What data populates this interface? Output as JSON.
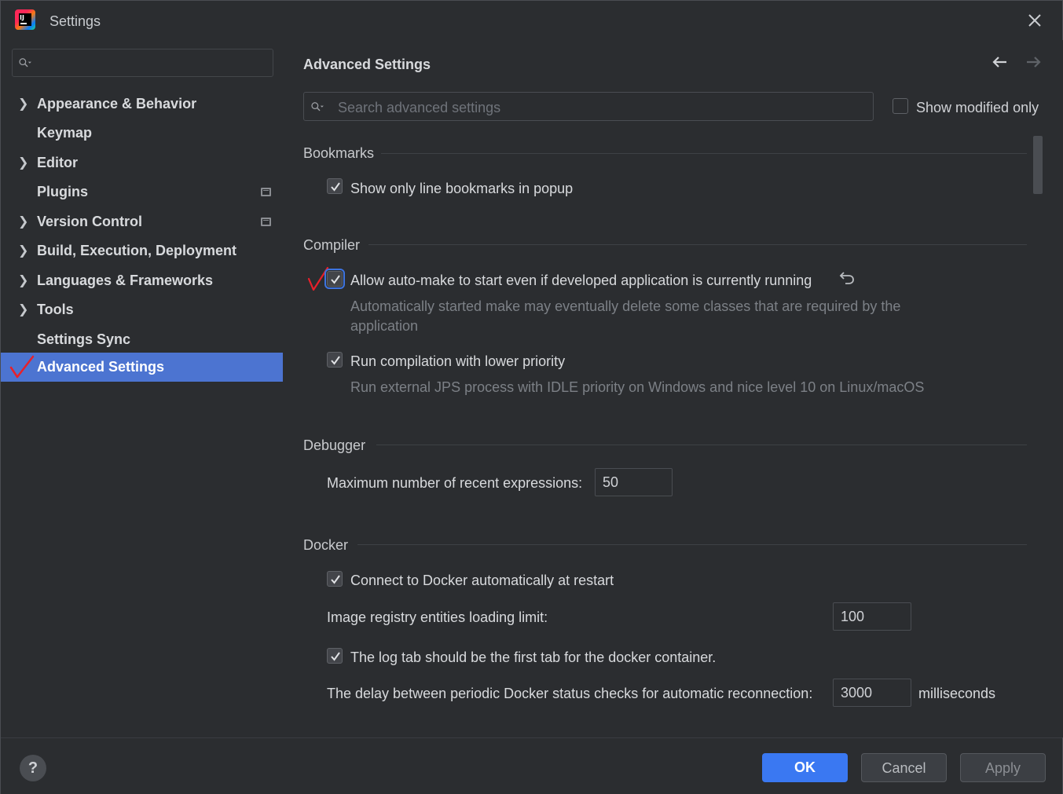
{
  "window": {
    "title": "Settings",
    "app_icon": "intellij-idea-logo",
    "app_icon_text": "IJ"
  },
  "sidebar": {
    "search_placeholder": "",
    "items": [
      {
        "label": "Appearance & Behavior",
        "expandable": true,
        "badge": false
      },
      {
        "label": "Keymap",
        "expandable": false,
        "badge": false
      },
      {
        "label": "Editor",
        "expandable": true,
        "badge": false
      },
      {
        "label": "Plugins",
        "expandable": false,
        "badge": true
      },
      {
        "label": "Version Control",
        "expandable": true,
        "badge": true
      },
      {
        "label": "Build, Execution, Deployment",
        "expandable": true,
        "badge": false
      },
      {
        "label": "Languages & Frameworks",
        "expandable": true,
        "badge": false
      },
      {
        "label": "Tools",
        "expandable": true,
        "badge": false
      },
      {
        "label": "Settings Sync",
        "expandable": false,
        "badge": false
      },
      {
        "label": "Advanced Settings",
        "expandable": false,
        "badge": false,
        "selected": true
      }
    ]
  },
  "main": {
    "title": "Advanced Settings",
    "search_placeholder": "Search advanced settings",
    "show_modified_label": "Show modified only",
    "show_modified_checked": false,
    "sections": {
      "bookmarks": {
        "title": "Bookmarks",
        "opt1_label": "Show only line bookmarks in popup",
        "opt1_checked": true
      },
      "compiler": {
        "title": "Compiler",
        "opt1_label": "Allow auto-make to start even if developed application is currently running",
        "opt1_checked": true,
        "opt1_desc_line1": "Automatically started make may eventually delete some classes that are required by the",
        "opt1_desc_line2": "application",
        "opt2_label": "Run compilation with lower priority",
        "opt2_checked": true,
        "opt2_desc": "Run external JPS process with IDLE priority on Windows and nice level 10 on Linux/macOS"
      },
      "debugger": {
        "title": "Debugger",
        "max_expr_label": "Maximum number of recent expressions:",
        "max_expr_value": "50"
      },
      "docker": {
        "title": "Docker",
        "opt1_label": "Connect to Docker automatically at restart",
        "opt1_checked": true,
        "limit_label": "Image registry entities loading limit:",
        "limit_value": "100",
        "opt2_label": "The log tab should be the first tab for the docker container.",
        "opt2_checked": true,
        "delay_label": "The delay between periodic Docker status checks for automatic reconnection:",
        "delay_value": "3000",
        "delay_unit": "milliseconds"
      }
    }
  },
  "footer": {
    "help_label": "?",
    "ok_label": "OK",
    "cancel_label": "Cancel",
    "apply_label": "Apply"
  },
  "colors": {
    "selection": "#4c74d1",
    "ok_button": "#3a78f2",
    "annotation_red": "#e8202a"
  }
}
